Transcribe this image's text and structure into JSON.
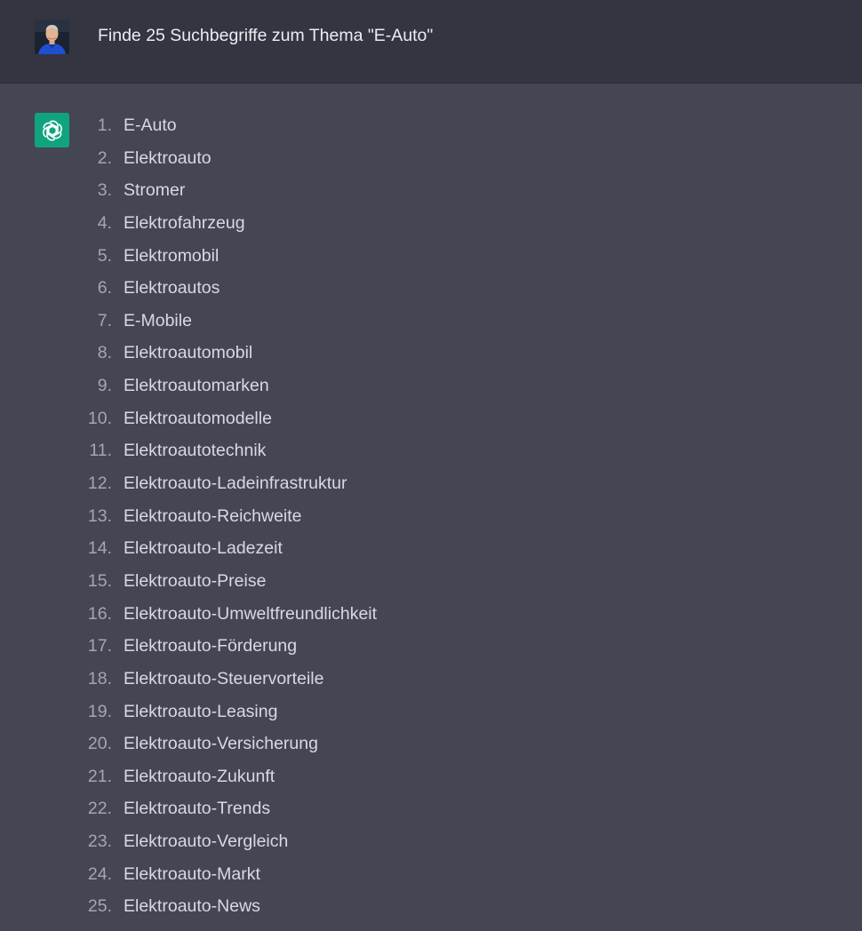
{
  "user": {
    "avatar_icon": "user-avatar-photo",
    "message": "Finde 25 Suchbegriffe zum Thema \"E-Auto\""
  },
  "assistant": {
    "icon": "openai-logo-icon",
    "icon_color": "#10a37f",
    "items": [
      {
        "num": "1.",
        "text": "E-Auto"
      },
      {
        "num": "2.",
        "text": "Elektroauto"
      },
      {
        "num": "3.",
        "text": "Stromer"
      },
      {
        "num": "4.",
        "text": "Elektrofahrzeug"
      },
      {
        "num": "5.",
        "text": "Elektromobil"
      },
      {
        "num": "6.",
        "text": "Elektroautos"
      },
      {
        "num": "7.",
        "text": "E-Mobile"
      },
      {
        "num": "8.",
        "text": "Elektroautomobil"
      },
      {
        "num": "9.",
        "text": "Elektroautomarken"
      },
      {
        "num": "10.",
        "text": "Elektroautomodelle"
      },
      {
        "num": "11.",
        "text": "Elektroautotechnik"
      },
      {
        "num": "12.",
        "text": "Elektroauto-Ladeinfrastruktur"
      },
      {
        "num": "13.",
        "text": "Elektroauto-Reichweite"
      },
      {
        "num": "14.",
        "text": "Elektroauto-Ladezeit"
      },
      {
        "num": "15.",
        "text": "Elektroauto-Preise"
      },
      {
        "num": "16.",
        "text": "Elektroauto-Umweltfreundlichkeit"
      },
      {
        "num": "17.",
        "text": "Elektroauto-Förderung"
      },
      {
        "num": "18.",
        "text": "Elektroauto-Steuervorteile"
      },
      {
        "num": "19.",
        "text": "Elektroauto-Leasing"
      },
      {
        "num": "20.",
        "text": "Elektroauto-Versicherung"
      },
      {
        "num": "21.",
        "text": "Elektroauto-Zukunft"
      },
      {
        "num": "22.",
        "text": "Elektroauto-Trends"
      },
      {
        "num": "23.",
        "text": "Elektroauto-Vergleich"
      },
      {
        "num": "24.",
        "text": "Elektroauto-Markt"
      },
      {
        "num": "25.",
        "text": "Elektroauto-News"
      }
    ]
  },
  "colors": {
    "user_background": "#343541",
    "assistant_background": "#444654",
    "text": "#d9d9e3",
    "number": "#a5a6b2"
  }
}
